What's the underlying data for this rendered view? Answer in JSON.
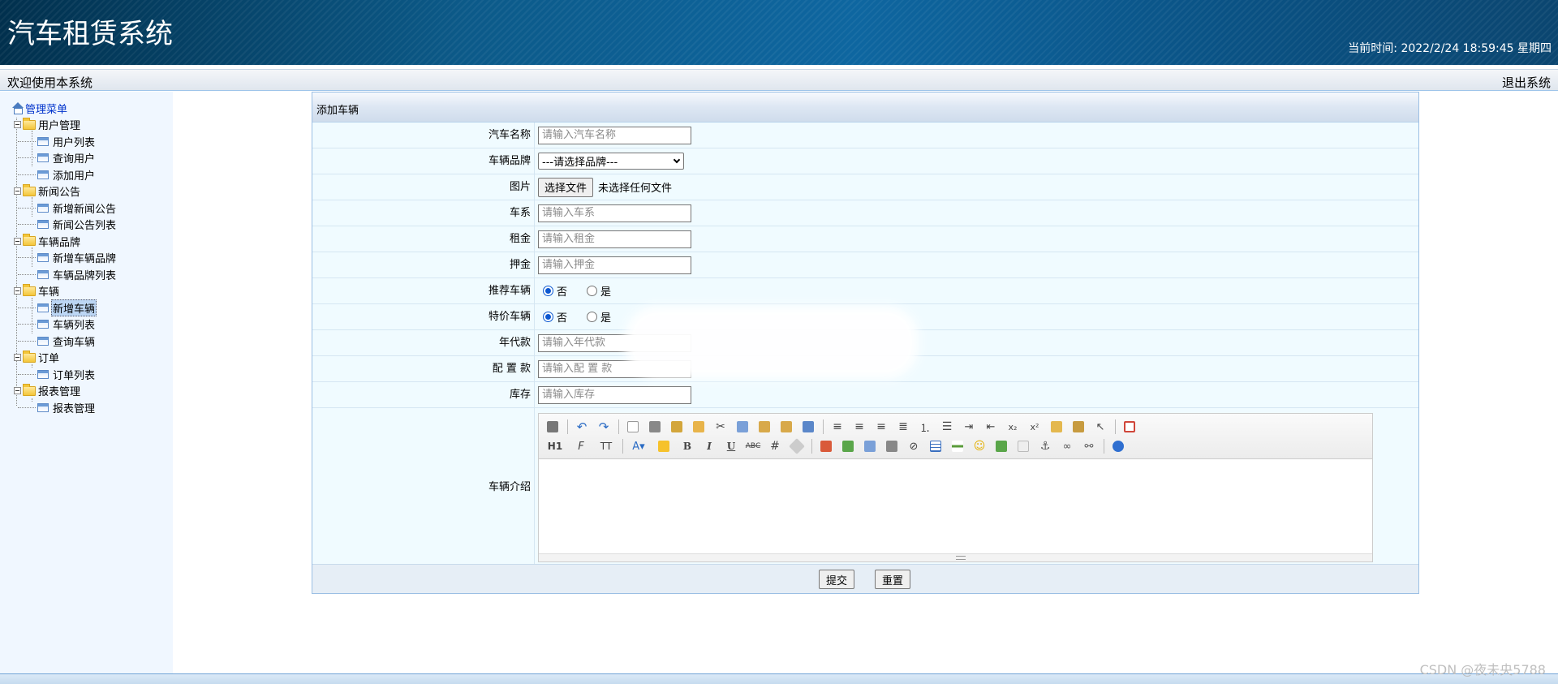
{
  "header": {
    "title": "汽车租赁系统",
    "clock_label": "当前时间: ",
    "clock_value": "2022/2/24 18:59:45 星期四"
  },
  "subbar": {
    "welcome": "欢迎使用本系统",
    "logout": "退出系统"
  },
  "sidebar": {
    "root": "管理菜单",
    "groups": [
      {
        "label": "用户管理",
        "items": [
          "用户列表",
          "查询用户",
          "添加用户"
        ]
      },
      {
        "label": "新闻公告",
        "items": [
          "新增新闻公告",
          "新闻公告列表"
        ]
      },
      {
        "label": "车辆品牌",
        "items": [
          "新增车辆品牌",
          "车辆品牌列表"
        ]
      },
      {
        "label": "车辆",
        "items": [
          "新增车辆",
          "车辆列表",
          "查询车辆"
        ],
        "selected": "新增车辆"
      },
      {
        "label": "订单",
        "items": [
          "订单列表"
        ]
      },
      {
        "label": "报表管理",
        "items": [
          "报表管理"
        ]
      }
    ]
  },
  "form": {
    "title": "添加车辆",
    "fields": {
      "name": {
        "label": "汽车名称",
        "placeholder": "请输入汽车名称"
      },
      "brand": {
        "label": "车辆品牌",
        "value": "---请选择品牌---"
      },
      "image": {
        "label": "图片",
        "button": "选择文件",
        "status": "未选择任何文件"
      },
      "series": {
        "label": "车系",
        "placeholder": "请输入车系"
      },
      "rent": {
        "label": "租金",
        "placeholder": "请输入租金"
      },
      "deposit": {
        "label": "押金",
        "placeholder": "请输入押金"
      },
      "recommend": {
        "label": "推荐车辆",
        "opt_no": "否",
        "opt_yes": "是",
        "selected": "否"
      },
      "special": {
        "label": "特价车辆",
        "opt_no": "否",
        "opt_yes": "是",
        "selected": "否"
      },
      "year": {
        "label": "年代款",
        "placeholder": "请输入年代款"
      },
      "config": {
        "label": "配 置 款",
        "placeholder": "请输入配 置 款"
      },
      "stock": {
        "label": "库存",
        "placeholder": "请输入库存"
      },
      "intro": {
        "label": "车辆介绍"
      }
    },
    "toolbar_row2_text": {
      "heading": "H1",
      "font": "F",
      "size": "TT",
      "bold": "B",
      "italic": "I",
      "underline": "U",
      "strike": "ABC"
    },
    "submit": "提交",
    "reset": "重置"
  },
  "watermark": "CSDN @夜未央5788",
  "colors": {
    "header_dark": "#01304d",
    "header_mid": "#0e66a0",
    "accent": "#0b57d0",
    "sidebar_bg": "#f0f7ff",
    "form_bg": "#f0fbff"
  }
}
